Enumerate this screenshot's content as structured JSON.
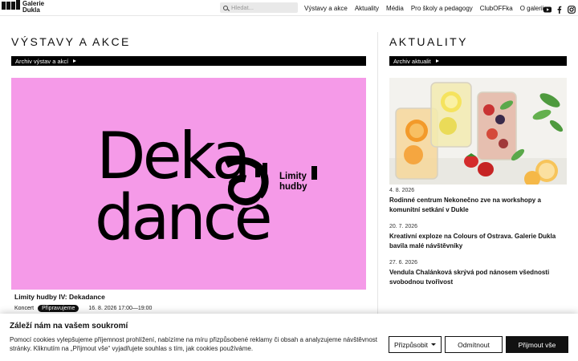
{
  "header": {
    "logo_line1": "Galerie",
    "logo_line2": "Dukla",
    "search_placeholder": "Hledat...",
    "nav": [
      "Výstavy a akce",
      "Aktuality",
      "Média",
      "Pro školy a pedagogy",
      "ClubOFFka",
      "O galerii"
    ],
    "social": [
      "youtube-icon",
      "facebook-icon",
      "instagram-icon"
    ]
  },
  "left": {
    "heading": "VÝSTAVY A AKCE",
    "archive_label": "Archiv výstav a akcí",
    "hero": {
      "background": "#f59ae8",
      "word_line1": "Deka",
      "word_line2": "dance",
      "subtitle_line1": "Limity",
      "subtitle_line2": "hudby"
    },
    "event": {
      "title": "Limity hudby IV: Dekadance",
      "category": "Koncert",
      "status": "Připravujeme",
      "date": "16. 8. 2026 17:00—19:00"
    }
  },
  "right": {
    "heading": "AKTUALITY",
    "archive_label": "Archiv aktualit",
    "news": [
      {
        "date": "4. 8. 2026",
        "title": "Rodinné centrum Nekonečno zve na workshopy a komunitní setkání v Dukle"
      },
      {
        "date": "20. 7. 2026",
        "title": "Kreativní exploze na Colours of Ostrava. Galerie Dukla bavila malé návštěvníky"
      },
      {
        "date": "27. 6. 2026",
        "title": "Vendula Chalánková skrývá pod nánosem všednosti svobodnou tvořivost"
      }
    ]
  },
  "cookie": {
    "title": "Záleží nám na vašem soukromí",
    "text": "Pomocí cookies vylepšujeme příjemnost prohlížení, nabízíme na míru přizpůsobené reklamy či obsah a analyzujeme návštěvnost stránky. Kliknutím na „Přijmout vše“ vyjadřujete souhlas s tím, jak cookies používáme.",
    "customize_label": "Přizpůsobit",
    "reject_label": "Odmítnout",
    "accept_label": "Přijmout vše"
  }
}
